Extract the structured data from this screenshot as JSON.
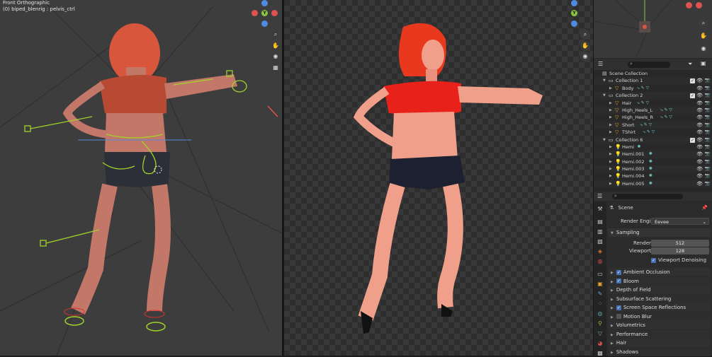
{
  "left_viewport": {
    "view_name": "Front Orthographic",
    "object_info": "(0) biped_blenrig : pelvis_ctrl"
  },
  "colors": {
    "x_axis": "#e0524f",
    "y_axis": "#8cc63f",
    "z_axis": "#4f8be0",
    "selection": "#334d80",
    "accent": "#4772b3"
  },
  "outliner": {
    "search_placeholder": "",
    "rows": [
      {
        "label": "Scene Collection",
        "icon": "scene-collection-icon",
        "depth": 0,
        "type": "scene"
      },
      {
        "label": "Collection 1",
        "icon": "collection-icon",
        "depth": 1,
        "type": "collection",
        "checked": true
      },
      {
        "label": "Body",
        "icon": "mesh-object-icon",
        "depth": 2,
        "type": "object",
        "extras": "⤷ ✎ ▽"
      },
      {
        "label": "Collection 2",
        "icon": "collection-icon",
        "depth": 1,
        "type": "collection",
        "checked": true
      },
      {
        "label": "Hair",
        "icon": "mesh-object-icon",
        "depth": 2,
        "type": "object",
        "extras": "⤷ ✎ ▽"
      },
      {
        "label": "High_Heels_L",
        "icon": "mesh-object-icon",
        "depth": 2,
        "type": "object",
        "extras": "⤷ ✎ ▽"
      },
      {
        "label": "High_Heels_R",
        "icon": "mesh-object-icon",
        "depth": 2,
        "type": "object",
        "extras": "⤷ ✎ ▽"
      },
      {
        "label": "Short",
        "icon": "mesh-object-icon",
        "depth": 2,
        "type": "object",
        "extras": "⤷ ✎ ▽"
      },
      {
        "label": "TShirt",
        "icon": "mesh-object-icon",
        "depth": 2,
        "type": "object",
        "extras": "⤷ ✎ ▽"
      },
      {
        "label": "Collection 6",
        "icon": "collection-icon",
        "depth": 1,
        "type": "collection",
        "checked": true
      },
      {
        "label": "Hemi",
        "icon": "light-icon",
        "depth": 2,
        "type": "light",
        "extras": "✺"
      },
      {
        "label": "Hemi.001",
        "icon": "light-icon",
        "depth": 2,
        "type": "light",
        "extras": "✺"
      },
      {
        "label": "Hemi.002",
        "icon": "light-icon",
        "depth": 2,
        "type": "light",
        "extras": "✺"
      },
      {
        "label": "Hemi.003",
        "icon": "light-icon",
        "depth": 2,
        "type": "light",
        "extras": "✺"
      },
      {
        "label": "Hemi.004",
        "icon": "light-icon",
        "depth": 2,
        "type": "light",
        "extras": "✺"
      },
      {
        "label": "Hemi.005",
        "icon": "light-icon",
        "depth": 2,
        "type": "light",
        "extras": "✺"
      }
    ]
  },
  "properties": {
    "context": "Scene",
    "render_engine_label": "Render Engine",
    "render_engine_value": "Eevee",
    "sampling": {
      "title": "Sampling",
      "render_label": "Render",
      "render_value": "512",
      "viewport_label": "Viewport",
      "viewport_value": "128",
      "denoise_label": "Viewport Denoising"
    },
    "sections": [
      {
        "label": "Ambient Occlusion",
        "checkbox": true
      },
      {
        "label": "Bloom",
        "checkbox": true
      },
      {
        "label": "Depth of Field",
        "checkbox": null
      },
      {
        "label": "Subsurface Scattering",
        "checkbox": null
      },
      {
        "label": "Screen Space Reflections",
        "checkbox": true
      },
      {
        "label": "Motion Blur",
        "checkbox": false
      },
      {
        "label": "Volumetrics",
        "checkbox": null
      },
      {
        "label": "Performance",
        "checkbox": null
      },
      {
        "label": "Hair",
        "checkbox": null
      },
      {
        "label": "Shadows",
        "checkbox": null
      }
    ]
  }
}
